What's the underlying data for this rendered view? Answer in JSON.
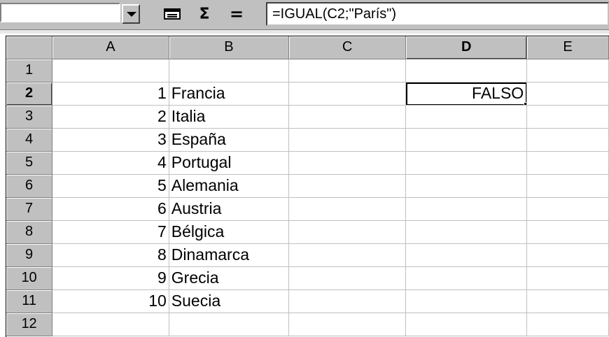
{
  "formula_bar": {
    "name_box": "",
    "formula": "=IGUAL(C2;\"París\")",
    "sum_label": "Σ",
    "equals_label": "="
  },
  "sheet": {
    "columns": [
      "A",
      "B",
      "C",
      "D",
      "E"
    ],
    "active_column": "D",
    "active_row": "2",
    "rows": [
      {
        "row": "1",
        "A": "",
        "B": "",
        "C": "",
        "D": ""
      },
      {
        "row": "2",
        "A": "1",
        "B": "Francia",
        "C": "",
        "D": "FALSO"
      },
      {
        "row": "3",
        "A": "2",
        "B": "Italia",
        "C": "",
        "D": ""
      },
      {
        "row": "4",
        "A": "3",
        "B": "España",
        "C": "",
        "D": ""
      },
      {
        "row": "5",
        "A": "4",
        "B": "Portugal",
        "C": "",
        "D": ""
      },
      {
        "row": "6",
        "A": "5",
        "B": "Alemania",
        "C": "",
        "D": ""
      },
      {
        "row": "7",
        "A": "6",
        "B": "Austria",
        "C": "",
        "D": ""
      },
      {
        "row": "8",
        "A": "7",
        "B": "Bélgica",
        "C": "",
        "D": ""
      },
      {
        "row": "9",
        "A": "8",
        "B": "Dinamarca",
        "C": "",
        "D": ""
      },
      {
        "row": "10",
        "A": "9",
        "B": "Grecia",
        "C": "",
        "D": ""
      },
      {
        "row": "11",
        "A": "10",
        "B": "Suecia",
        "C": "",
        "D": ""
      },
      {
        "row": "12",
        "A": "",
        "B": "",
        "C": "",
        "D": ""
      }
    ]
  },
  "icons": {
    "name_dropdown": "chevron-down-icon",
    "function_button": "function-wizard-icon",
    "sum_button": "sum-icon",
    "equals_button": "equals-icon"
  }
}
